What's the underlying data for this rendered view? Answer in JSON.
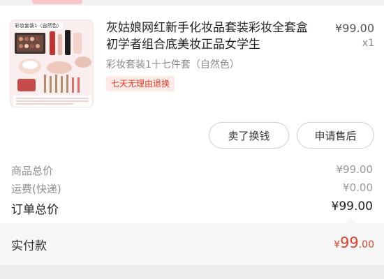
{
  "product": {
    "thumbnail_tag": "彩妆套装1（自然色）",
    "title_line1": "灰姑娘网红新手化妆品套装彩妆全套盒",
    "title_line2": "初学者组合底美妆正品女学生",
    "price": "¥99.00",
    "quantity": "x1",
    "sku": "彩妆套装1十七件套（自然色）",
    "badge": "七天无理由退换"
  },
  "actions": {
    "sell_label": "卖了换钱",
    "after_sale_label": "申请售后"
  },
  "summary": {
    "goods_total_label": "商品总价",
    "goods_total_value": "¥99.00",
    "shipping_label": "运费(快递)",
    "shipping_value": "¥0.00",
    "order_total_label": "订单总价",
    "order_total_value": "¥99.00"
  },
  "payment": {
    "label": "实付款",
    "currency": "¥",
    "amount_int": "99",
    "amount_dec": ".00"
  },
  "colors": {
    "accent": "#e0402a",
    "badge_bg": "#fde9e5"
  },
  "icons": {
    "thumbnail": "cosmetics-set-image"
  }
}
